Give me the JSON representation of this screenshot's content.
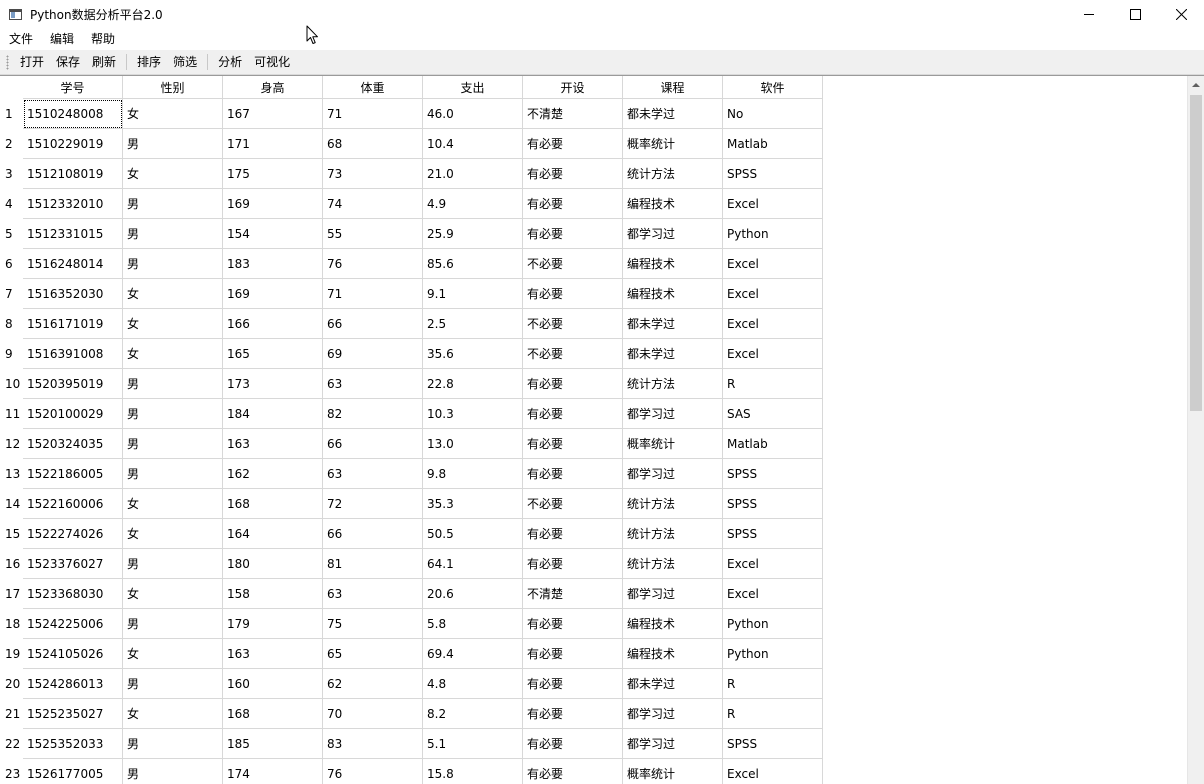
{
  "window": {
    "title": "Python数据分析平台2.0"
  },
  "menu": {
    "items": [
      "文件",
      "编辑",
      "帮助"
    ]
  },
  "toolbar": {
    "open": "打开",
    "save": "保存",
    "refresh": "刷新",
    "sort": "排序",
    "filter": "筛选",
    "analyze": "分析",
    "visualize": "可视化"
  },
  "table": {
    "columns": [
      "学号",
      "性别",
      "身高",
      "体重",
      "支出",
      "开设",
      "课程",
      "软件"
    ],
    "row_numbers": [
      "1",
      "2",
      "3",
      "4",
      "5",
      "6",
      "7",
      "8",
      "9",
      "10",
      "11",
      "12",
      "13",
      "14",
      "15",
      "16",
      "17",
      "18",
      "19",
      "20",
      "21",
      "22",
      "23"
    ],
    "rows": [
      [
        "1510248008",
        "女",
        "167",
        "71",
        "46.0",
        "不清楚",
        "都未学过",
        "No"
      ],
      [
        "1510229019",
        "男",
        "171",
        "68",
        "10.4",
        "有必要",
        "概率统计",
        "Matlab"
      ],
      [
        "1512108019",
        "女",
        "175",
        "73",
        "21.0",
        "有必要",
        "统计方法",
        "SPSS"
      ],
      [
        "1512332010",
        "男",
        "169",
        "74",
        "4.9",
        "有必要",
        "编程技术",
        "Excel"
      ],
      [
        "1512331015",
        "男",
        "154",
        "55",
        "25.9",
        "有必要",
        "都学习过",
        "Python"
      ],
      [
        "1516248014",
        "男",
        "183",
        "76",
        "85.6",
        "不必要",
        "编程技术",
        "Excel"
      ],
      [
        "1516352030",
        "女",
        "169",
        "71",
        "9.1",
        "有必要",
        "编程技术",
        "Excel"
      ],
      [
        "1516171019",
        "女",
        "166",
        "66",
        "2.5",
        "不必要",
        "都未学过",
        "Excel"
      ],
      [
        "1516391008",
        "女",
        "165",
        "69",
        "35.6",
        "不必要",
        "都未学过",
        "Excel"
      ],
      [
        "1520395019",
        "男",
        "173",
        "63",
        "22.8",
        "有必要",
        "统计方法",
        "R"
      ],
      [
        "1520100029",
        "男",
        "184",
        "82",
        "10.3",
        "有必要",
        "都学习过",
        "SAS"
      ],
      [
        "1520324035",
        "男",
        "163",
        "66",
        "13.0",
        "有必要",
        "概率统计",
        "Matlab"
      ],
      [
        "1522186005",
        "男",
        "162",
        "63",
        "9.8",
        "有必要",
        "都学习过",
        "SPSS"
      ],
      [
        "1522160006",
        "女",
        "168",
        "72",
        "35.3",
        "不必要",
        "统计方法",
        "SPSS"
      ],
      [
        "1522274026",
        "女",
        "164",
        "66",
        "50.5",
        "有必要",
        "统计方法",
        "SPSS"
      ],
      [
        "1523376027",
        "男",
        "180",
        "81",
        "64.1",
        "有必要",
        "统计方法",
        "Excel"
      ],
      [
        "1523368030",
        "女",
        "158",
        "63",
        "20.6",
        "不清楚",
        "都学习过",
        "Excel"
      ],
      [
        "1524225006",
        "男",
        "179",
        "75",
        "5.8",
        "有必要",
        "编程技术",
        "Python"
      ],
      [
        "1524105026",
        "女",
        "163",
        "65",
        "69.4",
        "有必要",
        "编程技术",
        "Python"
      ],
      [
        "1524286013",
        "男",
        "160",
        "62",
        "4.8",
        "有必要",
        "都未学过",
        "R"
      ],
      [
        "1525235027",
        "女",
        "168",
        "70",
        "8.2",
        "有必要",
        "都学习过",
        "R"
      ],
      [
        "1525352033",
        "男",
        "185",
        "83",
        "5.1",
        "有必要",
        "都学习过",
        "SPSS"
      ],
      [
        "1526177005",
        "男",
        "174",
        "76",
        "15.8",
        "有必要",
        "概率统计",
        "Excel"
      ]
    ]
  },
  "scrollbar": {
    "visible_fraction": 0.46
  },
  "icons": {
    "app": "app-window-icon",
    "minimize": "minimize-icon",
    "maximize": "maximize-icon",
    "close": "close-icon",
    "cursor": "mouse-cursor-icon"
  }
}
